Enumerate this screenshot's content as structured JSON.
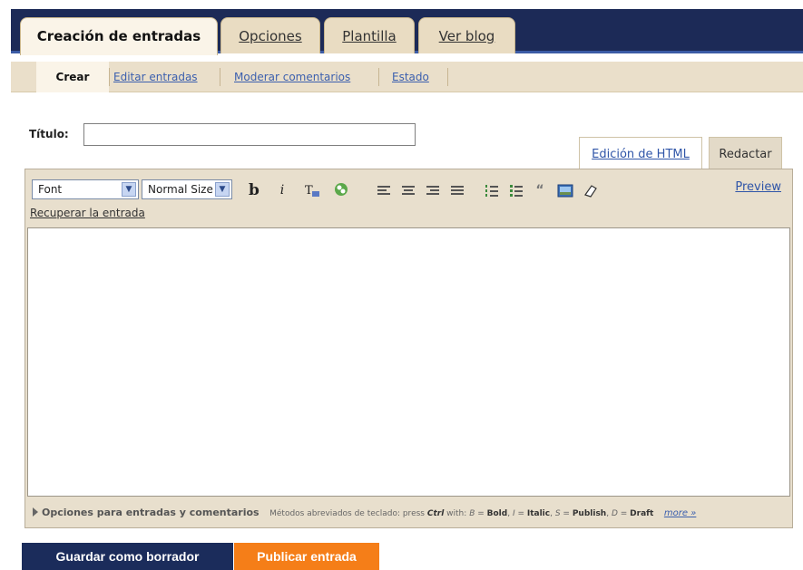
{
  "nav": {
    "tabs": [
      {
        "label": "Creación de entradas",
        "active": true
      },
      {
        "label": "Opciones",
        "active": false
      },
      {
        "label": "Plantilla",
        "active": false
      },
      {
        "label": "Ver blog",
        "active": false
      }
    ]
  },
  "subnav": {
    "items": [
      {
        "label": "Crear",
        "active": true
      },
      {
        "label": "Editar entradas",
        "active": false
      },
      {
        "label": "Moderar comentarios",
        "active": false
      },
      {
        "label": "Estado",
        "active": false
      }
    ]
  },
  "post": {
    "title_label": "Título:",
    "title_value": ""
  },
  "mode_tabs": {
    "html": "Edición de HTML",
    "compose": "Redactar"
  },
  "toolbar": {
    "font_select": "Font",
    "size_select": "Normal Size",
    "preview": "Preview",
    "recover": "Recuperar la entrada",
    "icons": [
      "bold-icon",
      "italic-icon",
      "text-color-icon",
      "link-icon",
      "align-left-icon",
      "align-center-icon",
      "align-right-icon",
      "align-justify-icon",
      "numbered-list-icon",
      "bullet-list-icon",
      "blockquote-icon",
      "image-icon",
      "remove-format-icon"
    ]
  },
  "footer": {
    "options_label": "Opciones para entradas y comentarios",
    "shortcuts_prefix": "Métodos abreviados de teclado: press",
    "shortcuts_ctrl": "Ctrl",
    "shortcuts_with": "with:",
    "sc_b": "B",
    "sc_b_label": "Bold",
    "sc_i": "I",
    "sc_i_label": "Italic",
    "sc_s": "S",
    "sc_s_label": "Publish",
    "sc_d": "D",
    "sc_d_label": "Draft",
    "more": "more »"
  },
  "actions": {
    "save_draft": "Guardar como borrador",
    "publish": "Publicar entrada"
  },
  "colors": {
    "navy": "#1c2a57",
    "tab_bg": "#e9dcc2",
    "link_blue": "#2f55a8",
    "publish_orange": "#f57e18"
  }
}
